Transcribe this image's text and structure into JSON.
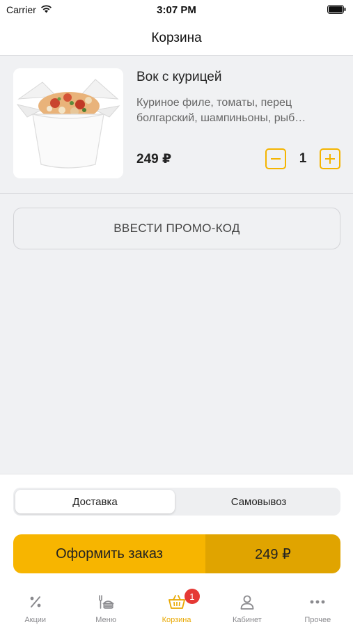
{
  "status_bar": {
    "carrier": "Carrier",
    "time": "3:07 PM",
    "icons": [
      "wifi-icon",
      "battery-icon"
    ]
  },
  "header": {
    "title": "Корзина"
  },
  "cart": {
    "items": [
      {
        "name": "Вок с курицей",
        "description_line1": "Куриное филе, томаты, перец",
        "description_line2": "болгарский, шампиньоны, рыб…",
        "price": "249 ₽",
        "quantity": "1",
        "image_icon": "wok-box-image"
      }
    ]
  },
  "promo": {
    "label": "ВВЕСТИ ПРОМО-КОД"
  },
  "delivery": {
    "options": [
      "Доставка",
      "Самовывоз"
    ],
    "selected": "Доставка"
  },
  "checkout": {
    "label": "Оформить заказ",
    "total": "249 ₽"
  },
  "tabbar": {
    "tabs": [
      {
        "label": "Акции",
        "icon": "percent-icon"
      },
      {
        "label": "Меню",
        "icon": "menu-food-icon"
      },
      {
        "label": "Корзина",
        "icon": "basket-icon",
        "badge": "1",
        "active": true
      },
      {
        "label": "Кабинет",
        "icon": "user-icon"
      },
      {
        "label": "Прочее",
        "icon": "more-icon"
      }
    ]
  },
  "colors": {
    "accent": "#f7b500",
    "accent_dark": "#e0a400",
    "badge": "#e53935",
    "background": "#f0f1f3"
  }
}
